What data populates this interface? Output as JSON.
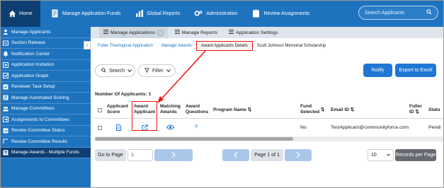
{
  "nav": {
    "home": "Home",
    "items": [
      "Manage Application Funds",
      "Global Reports",
      "Administration",
      "Review Assignments"
    ],
    "search_placeholder": "Search Applicants"
  },
  "sidebar": {
    "items": [
      "Manage Applicants",
      "Section Release",
      "Notification Center",
      "Application Invitation",
      "Application Graph",
      "Reviewer Task Setup",
      "Manage Automated Scoring",
      "Manage Committees",
      "Assignments to Committees",
      "Review Committee Status",
      "Review Committee Results",
      "Manage Awards - Multiple Funds"
    ],
    "collapse_glyph": "‹"
  },
  "subnav": {
    "items": [
      "Manage Applications",
      "Manage Reports",
      "Application Settings"
    ]
  },
  "crumbs": [
    "Fuller Theological Application",
    "Manage Awards",
    "Award Applicants Details",
    "Scott Johnson Memorial Scholarship"
  ],
  "toolbar": {
    "search": "Search",
    "filter": "Filter",
    "notify": "Notify",
    "export": "Export to Excel"
  },
  "count_label": "Number Of Applicants: 1",
  "table": {
    "headers": {
      "applicant_score": [
        "Applicant",
        "Score"
      ],
      "award_applicant": [
        "Award",
        "Applicant"
      ],
      "matching_awards": [
        "Matching",
        "Awards"
      ],
      "award_questions": [
        "Award",
        "Questions"
      ],
      "program_name": "Program Name",
      "fund_selected": [
        "Fund",
        "Selected"
      ],
      "email_id": "Email ID",
      "fuller_id": [
        "Fuller",
        "ID"
      ],
      "status": "Statu"
    },
    "rows": [
      {
        "fund_selected": "No",
        "email": "TestApplicant@communityforce.com",
        "status": "Pendi"
      }
    ],
    "questions_glyph": "?"
  },
  "pager": {
    "goto": "Go to Page",
    "page_input": "1",
    "page_label": "Page 1 of 1",
    "per_page_value": "10",
    "per_page_label": "Records per Page"
  },
  "colors": {
    "nav_blue": "#1e73be",
    "nav_dark": "#0d3f73",
    "button_blue": "#1f77d4",
    "annotation_red": "#e11111"
  }
}
